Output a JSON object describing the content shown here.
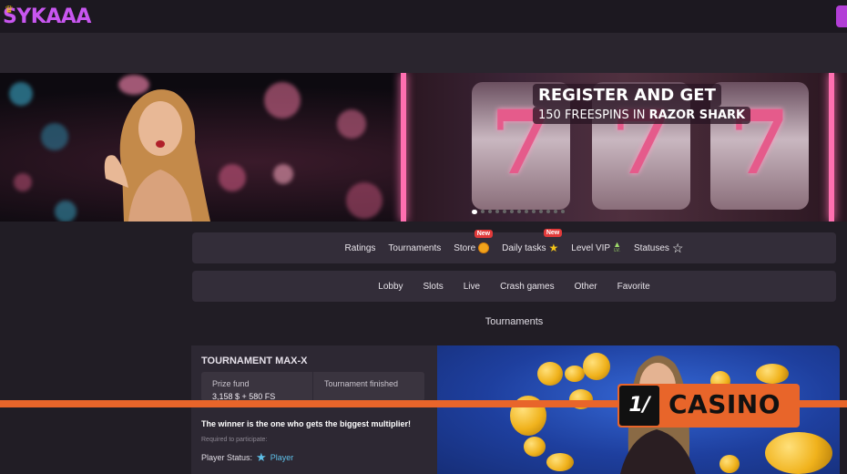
{
  "header": {
    "logo_text": "SYKAAA",
    "crown_icon": "crown-icon"
  },
  "banner": {
    "promo_title": "REGISTER AND GET",
    "promo_sub_prefix": "150 FREESPINS IN",
    "promo_sub_game": "RAZOR SHARK",
    "slide_count": 13,
    "active_slide": 1
  },
  "nav_primary": {
    "items": [
      {
        "label": "Ratings"
      },
      {
        "label": "Tournaments"
      },
      {
        "label": "Store",
        "badge": "New",
        "icon": "coin-icon"
      },
      {
        "label": "Daily tasks",
        "badge": "New",
        "icon": "star-icon"
      },
      {
        "label": "Level VIP",
        "icon": "level-up-icon",
        "icon_text": "LV."
      },
      {
        "label": "Statuses",
        "icon": "star-outline-icon"
      }
    ]
  },
  "nav_secondary": {
    "items": [
      {
        "label": "Lobby"
      },
      {
        "label": "Slots"
      },
      {
        "label": "Live"
      },
      {
        "label": "Crash games"
      },
      {
        "label": "Other"
      },
      {
        "label": "Favorite"
      }
    ]
  },
  "section": {
    "title": "Tournaments"
  },
  "tournament": {
    "name": "TOURNAMENT MAX-X",
    "prize_label": "Prize fund",
    "prize_value": "3,158 $ + 580 FS",
    "status_label": "Tournament finished",
    "description": "The winner is the one who gets the biggest multiplier!",
    "required_label": "Required to participate:",
    "player_status_label": "Player Status:",
    "player_status_value": "Player"
  },
  "watermark": {
    "logo_glyph": "1/",
    "text": "CASINO"
  },
  "colors": {
    "background": "#211d25",
    "panel": "#332d39",
    "accent_purple": "#c856f0",
    "watermark_orange": "#e8652a",
    "badge_red": "#e23a3a",
    "status_blue": "#5ec0e8"
  }
}
